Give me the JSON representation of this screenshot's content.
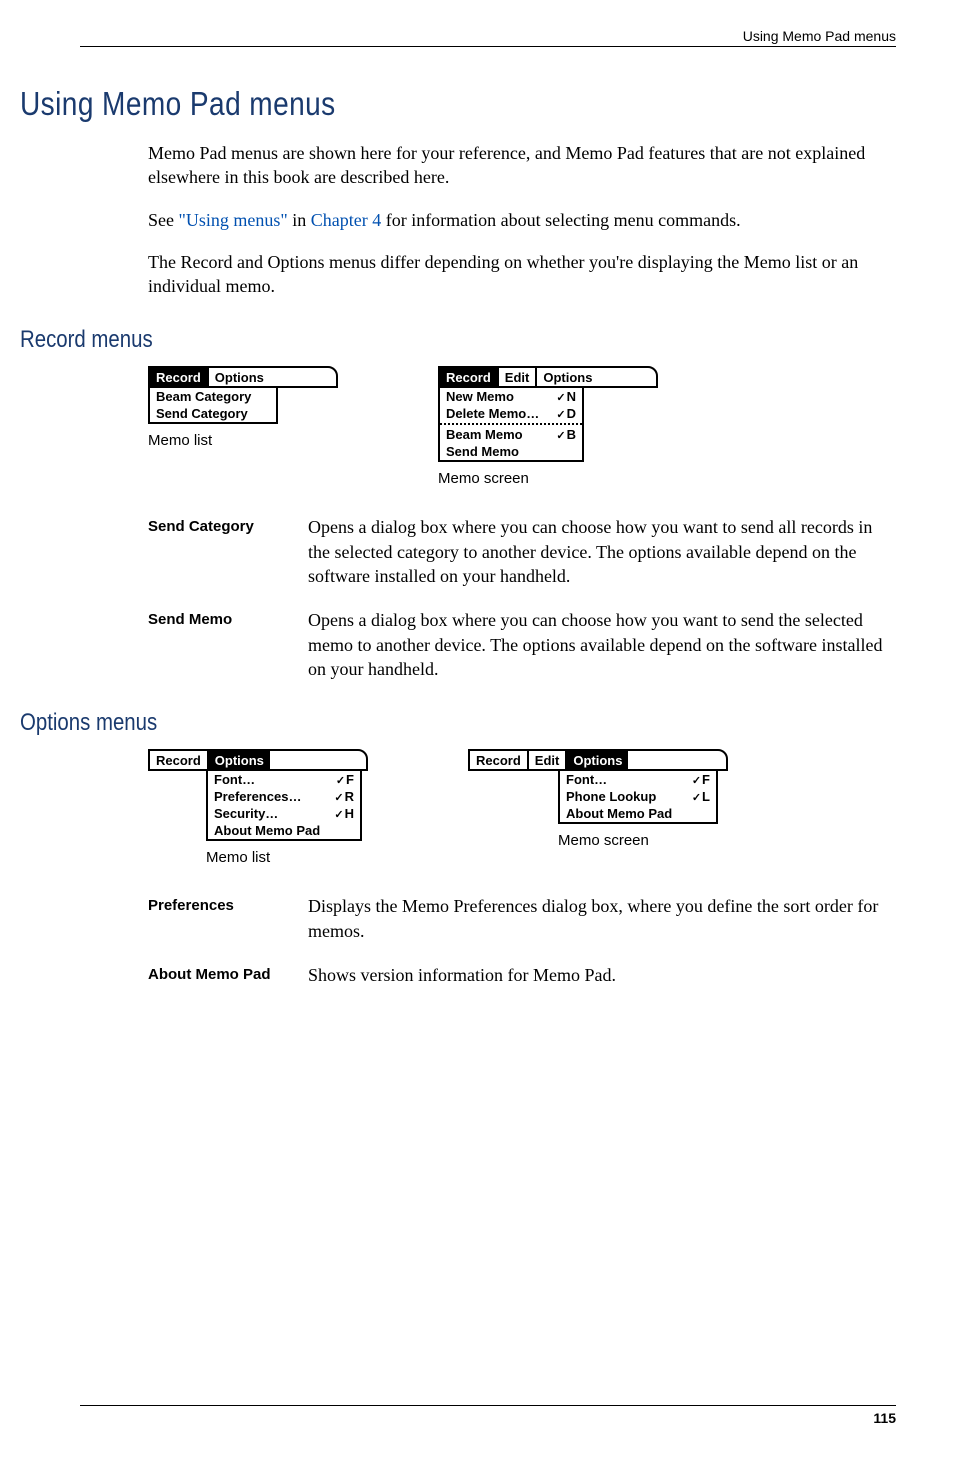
{
  "header": {
    "running_title": "Using Memo Pad menus"
  },
  "title": "Using Memo Pad menus",
  "intro": {
    "p1": "Memo Pad menus are shown here for your reference, and Memo Pad features that are not explained elsewhere in this book are described here.",
    "p2_pre": "See ",
    "p2_link1": "\"Using menus\"",
    "p2_mid": " in ",
    "p2_link2": "Chapter 4",
    "p2_post": " for information about selecting menu commands.",
    "p3": "The Record and Options menus differ depending on whether you're displaying the Memo list or an individual memo."
  },
  "record_section": {
    "heading": "Record menus",
    "list_caption": "Memo list",
    "screen_caption": "Memo screen",
    "list_menu": {
      "tabs": [
        "Record",
        "Options"
      ],
      "active": 0,
      "items": [
        "Beam Category",
        "Send Category"
      ]
    },
    "screen_menu": {
      "tabs": [
        "Record",
        "Edit",
        "Options"
      ],
      "active": 0,
      "groups": [
        [
          {
            "label": "New Memo",
            "shortcut": "N"
          },
          {
            "label": "Delete Memo…",
            "shortcut": "D"
          }
        ],
        [
          {
            "label": "Beam Memo",
            "shortcut": "B"
          },
          {
            "label": "Send Memo",
            "shortcut": ""
          }
        ]
      ]
    },
    "defs": [
      {
        "term": "Send Category",
        "body": "Opens a dialog box where you can choose how you want to send all records in the selected category to another device. The options available depend on the software installed on your handheld."
      },
      {
        "term": "Send Memo",
        "body": "Opens a dialog box where you can choose how you want to send the selected memo to another device. The options available depend on the software installed on your handheld."
      }
    ]
  },
  "options_section": {
    "heading": "Options menus",
    "list_caption": "Memo list",
    "screen_caption": "Memo screen",
    "list_menu": {
      "tabs": [
        "Record",
        "Options"
      ],
      "active": 1,
      "items": [
        {
          "label": "Font…",
          "shortcut": "F"
        },
        {
          "label": "Preferences…",
          "shortcut": "R"
        },
        {
          "label": "Security…",
          "shortcut": "H"
        },
        {
          "label": "About Memo Pad",
          "shortcut": ""
        }
      ]
    },
    "screen_menu": {
      "tabs": [
        "Record",
        "Edit",
        "Options"
      ],
      "active": 2,
      "items": [
        {
          "label": "Font…",
          "shortcut": "F"
        },
        {
          "label": "Phone Lookup",
          "shortcut": "L"
        },
        {
          "label": "About Memo Pad",
          "shortcut": ""
        }
      ]
    },
    "defs": [
      {
        "term": "Preferences",
        "body": "Displays the Memo Preferences dialog box, where you define the sort order for memos."
      },
      {
        "term": "About Memo Pad",
        "body": "Shows version information for Memo Pad."
      }
    ]
  },
  "footer": {
    "page_number": "115"
  }
}
